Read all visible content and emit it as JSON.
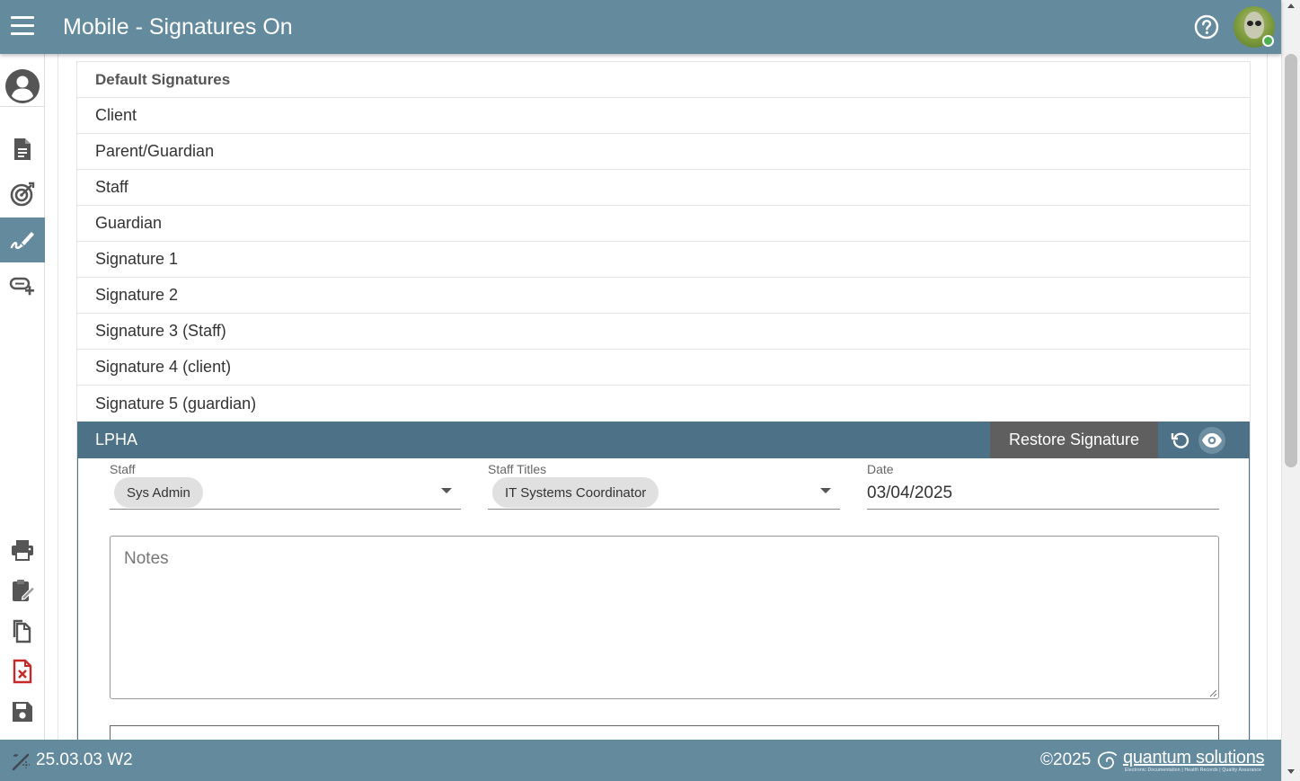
{
  "header": {
    "title": "Mobile - Signatures On"
  },
  "panel": {
    "header": "Default Signatures",
    "items": [
      "Client",
      "Parent/Guardian",
      "Staff",
      "Guardian",
      "Signature 1",
      "Signature 2",
      "Signature 3 (Staff)",
      "Signature 4 (client)",
      "Signature 5 (guardian)"
    ]
  },
  "lpha": {
    "title": "LPHA",
    "restore_label": "Restore Signature"
  },
  "form": {
    "staff_label": "Staff",
    "staff_value": "Sys Admin",
    "titles_label": "Staff Titles",
    "titles_value": "IT Systems Coordinator",
    "date_label": "Date",
    "date_value": "03/04/2025",
    "notes_placeholder": "Notes"
  },
  "footer": {
    "version": "25.03.03 W2",
    "copyright": "©2025",
    "brand": "quantum solutions",
    "brand_sub": "Electronic Documentation  |  Health Records  |  Quality Assurance"
  },
  "icons": {
    "menu": "hamburger-menu-icon",
    "help": "help-circle-icon",
    "user": "account-circle-icon",
    "document": "document-icon",
    "goals": "target-icon",
    "signature": "signature-pen-icon",
    "add_link": "add-link-icon",
    "print": "printer-icon",
    "edit_clipboard": "clipboard-edit-icon",
    "copy": "copy-document-icon",
    "delete_doc": "delete-document-icon",
    "save": "floppy-save-icon",
    "restore": "restore-icon",
    "view": "eye-icon"
  },
  "colors": {
    "topbar": "#648a9e",
    "lpha_bar": "#4d7186",
    "restore_button": "#5f5f5f",
    "delete_icon": "#c62828",
    "status_online": "#4caf50"
  }
}
